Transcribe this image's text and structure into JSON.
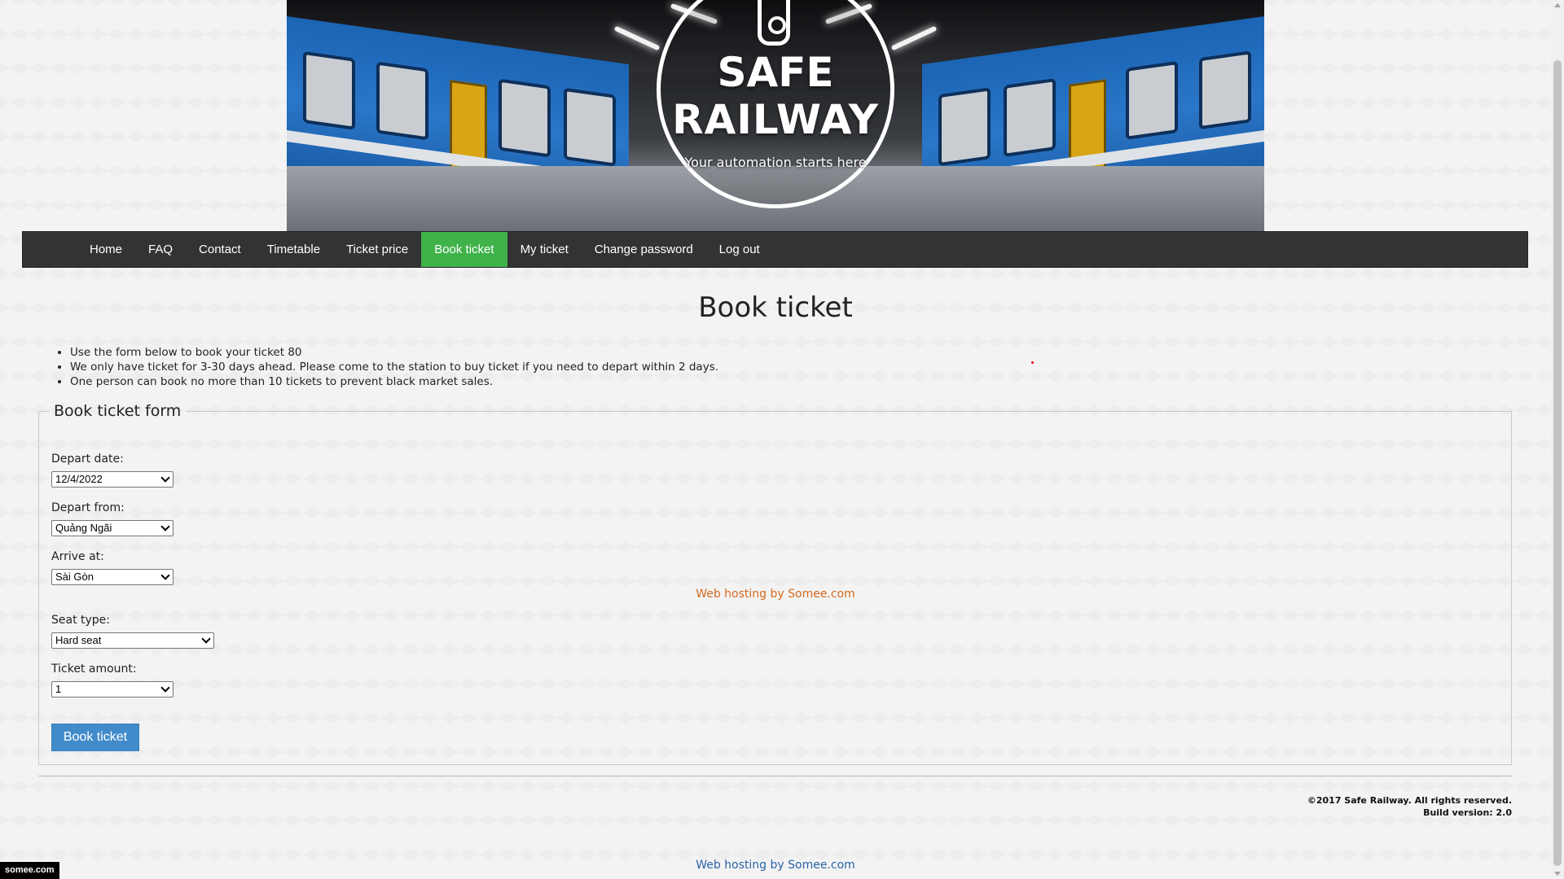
{
  "banner": {
    "title_line1": "SAFE",
    "title_line2": "RAILWAY",
    "tagline": "Your automation starts here"
  },
  "nav": {
    "items": [
      {
        "label": "Home"
      },
      {
        "label": "FAQ"
      },
      {
        "label": "Contact"
      },
      {
        "label": "Timetable"
      },
      {
        "label": "Ticket price"
      },
      {
        "label": "Book ticket",
        "active": true
      },
      {
        "label": "My ticket"
      },
      {
        "label": "Change password"
      },
      {
        "label": "Log out"
      }
    ],
    "active_color": "#3fb24a",
    "bg_color": "#333333"
  },
  "page": {
    "title": "Book ticket",
    "notes": [
      "Use the form below to book your ticket 80",
      "We only have ticket for 3-30 days ahead. Please come to the station to buy ticket if you need to depart within 2 days.",
      "One person can book no more than 10 tickets to prevent black market sales."
    ]
  },
  "form": {
    "legend": "Book ticket form",
    "depart_date": {
      "label": "Depart date:",
      "value": "12/4/2022"
    },
    "depart_from": {
      "label": "Depart from:",
      "value": "Quảng Ngãi"
    },
    "arrive_at": {
      "label": "Arrive at:",
      "value": "Sài Gòn"
    },
    "seat_type": {
      "label": "Seat type:",
      "value": "Hard seat"
    },
    "ticket_amount": {
      "label": "Ticket amount:",
      "value": "1"
    },
    "submit_label": "Book ticket"
  },
  "hosting_mid": "Web hosting by Somee.com",
  "footer": {
    "copyright": "©2017 Safe Railway. All rights reserved.",
    "build": "Build version: 2.0"
  },
  "hosting_bottom": "Web hosting by Somee.com",
  "somee_badge": "somee.com"
}
